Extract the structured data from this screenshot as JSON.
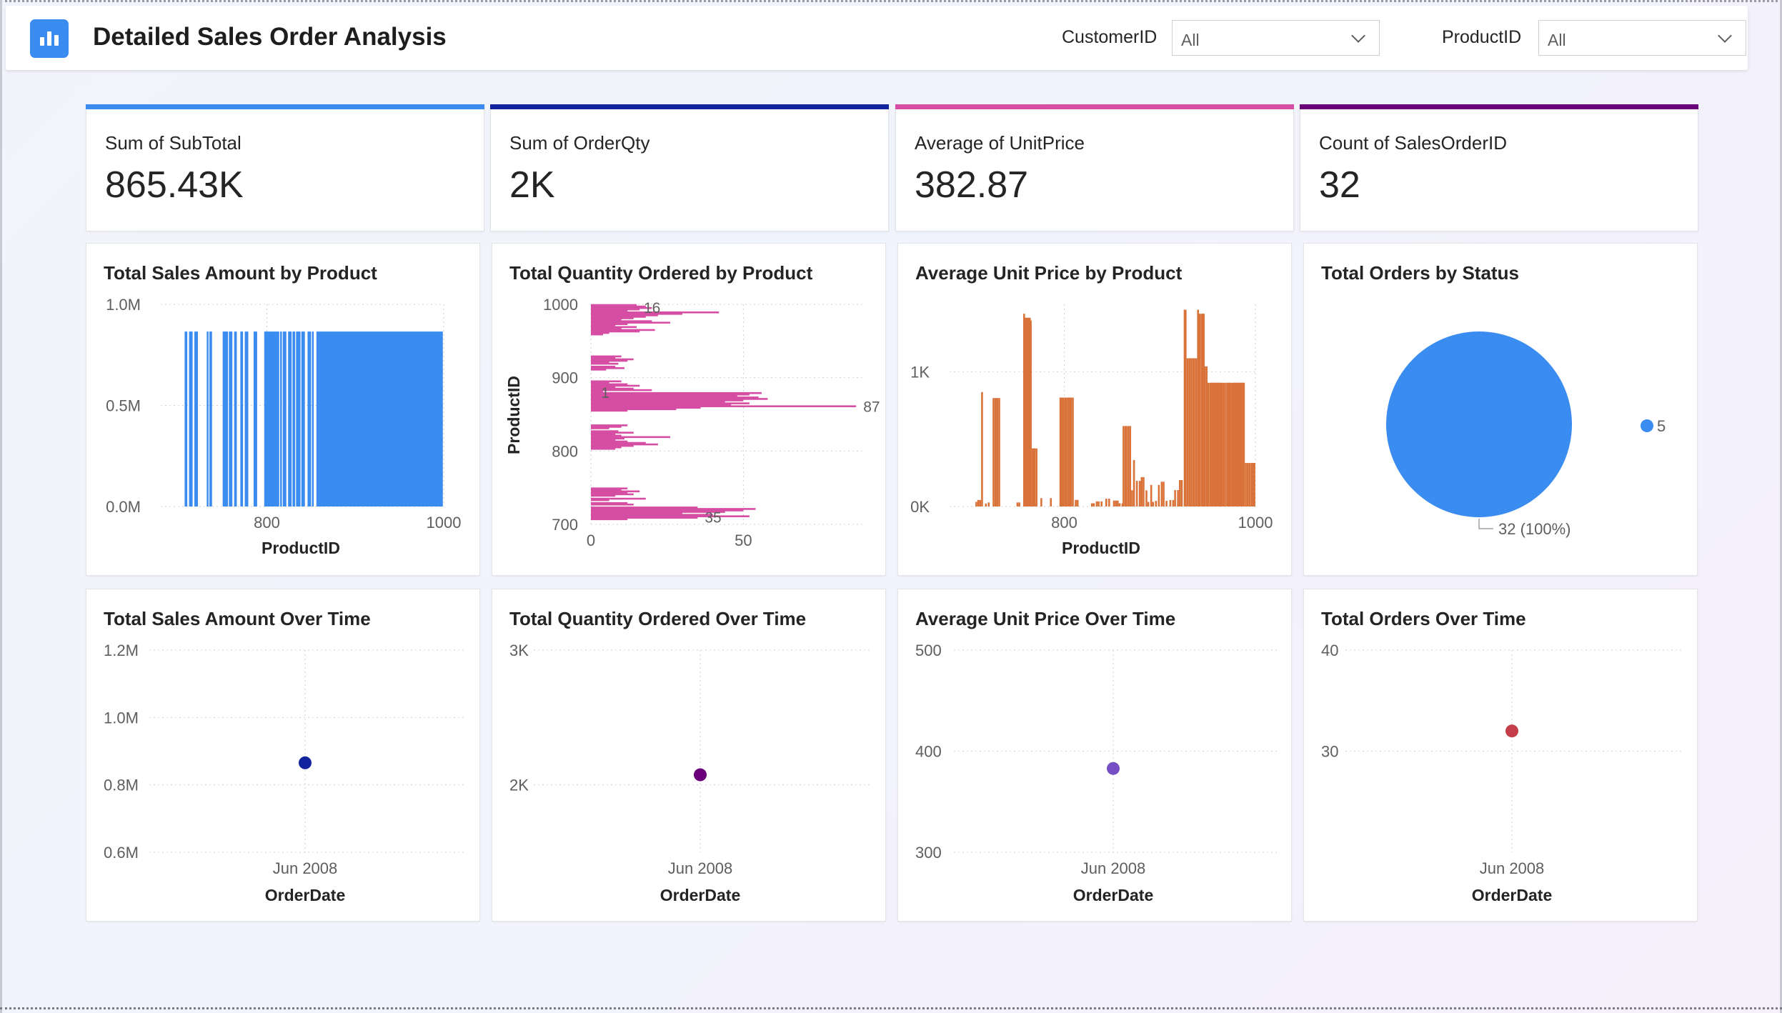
{
  "header": {
    "title": "Detailed Sales Order Analysis",
    "logo_icon": "bar-chart-icon",
    "slicers": [
      {
        "label": "CustomerID",
        "value": "All"
      },
      {
        "label": "ProductID",
        "value": "All"
      }
    ]
  },
  "kpis": [
    {
      "label": "Sum of SubTotal",
      "value": "865.43K",
      "color": "#3b8cf0"
    },
    {
      "label": "Sum of OrderQty",
      "value": "2K",
      "color": "#12239e"
    },
    {
      "label": "Average of UnitPrice",
      "value": "382.87",
      "color": "#d64ea3"
    },
    {
      "label": "Count of SalesOrderID",
      "value": "32",
      "color": "#6b007b"
    }
  ],
  "panels": {
    "sales_by_product": "Total Sales Amount by Product",
    "qty_by_product": "Total Quantity Ordered by Product",
    "price_by_product": "Average Unit Price by Product",
    "orders_by_status": "Total Orders by Status",
    "sales_over_time": "Total Sales Amount Over Time",
    "qty_over_time": "Total Quantity Ordered Over Time",
    "price_over_time": "Average Unit Price Over Time",
    "orders_over_time": "Total Orders Over Time"
  },
  "chart_data": [
    {
      "id": "sales_by_product",
      "type": "bar",
      "title": "Total Sales Amount by Product",
      "xlabel": "ProductID",
      "ylabel": "",
      "color": "#3b8cf0",
      "xlim": [
        680,
        1000
      ],
      "ylim": [
        0,
        1000000
      ],
      "x_ticks": [
        "800",
        "1000"
      ],
      "y_ticks": [
        "0.0M",
        "0.5M",
        "1.0M"
      ],
      "bar_value": 865430,
      "x_ranges": [
        [
          707,
          710
        ],
        [
          712,
          716
        ],
        [
          718,
          722
        ],
        [
          732,
          734
        ],
        [
          735,
          738
        ],
        [
          750,
          756
        ],
        [
          757,
          761
        ],
        [
          763,
          766
        ],
        [
          770,
          773
        ],
        [
          775,
          779
        ],
        [
          785,
          789
        ],
        [
          797,
          814
        ],
        [
          815,
          817
        ],
        [
          818,
          822
        ],
        [
          824,
          828
        ],
        [
          829,
          832
        ],
        [
          833,
          838
        ],
        [
          839,
          843
        ],
        [
          846,
          850
        ],
        [
          851,
          853
        ],
        [
          856,
          999
        ]
      ]
    },
    {
      "id": "qty_by_product",
      "type": "bar",
      "orientation": "horizontal",
      "title": "Total Quantity Ordered by Product",
      "xlabel": "",
      "ylabel": "ProductID",
      "color": "#d64ea3",
      "xlim": [
        0,
        90
      ],
      "ylim": [
        700,
        1000
      ],
      "x_ticks": [
        "0",
        "50"
      ],
      "y_ticks": [
        "700",
        "800",
        "900",
        "1000"
      ],
      "data_labels": [
        {
          "y": 996,
          "value": "16"
        },
        {
          "y": 880,
          "value": "1"
        },
        {
          "y": 861,
          "value": "87"
        },
        {
          "y": 710,
          "value": "35"
        }
      ],
      "bars": [
        [
          999,
          15
        ],
        [
          997,
          18
        ],
        [
          995,
          20
        ],
        [
          993,
          16
        ],
        [
          991,
          12
        ],
        [
          989,
          42
        ],
        [
          987,
          30
        ],
        [
          985,
          22
        ],
        [
          983,
          18
        ],
        [
          981,
          14
        ],
        [
          979,
          10
        ],
        [
          977,
          20
        ],
        [
          975,
          26
        ],
        [
          973,
          12
        ],
        [
          971,
          8
        ],
        [
          969,
          15
        ],
        [
          967,
          10
        ],
        [
          965,
          21
        ],
        [
          963,
          16
        ],
        [
          961,
          6
        ],
        [
          959,
          4
        ],
        [
          929,
          10
        ],
        [
          927,
          8
        ],
        [
          925,
          14
        ],
        [
          923,
          12
        ],
        [
          921,
          6
        ],
        [
          919,
          9
        ],
        [
          915,
          8
        ],
        [
          913,
          11
        ],
        [
          911,
          5
        ],
        [
          895,
          10
        ],
        [
          893,
          6
        ],
        [
          891,
          12
        ],
        [
          889,
          16
        ],
        [
          887,
          8
        ],
        [
          885,
          14
        ],
        [
          883,
          20
        ],
        [
          881,
          4
        ],
        [
          879,
          56
        ],
        [
          877,
          52
        ],
        [
          875,
          48
        ],
        [
          873,
          55
        ],
        [
          871,
          58
        ],
        [
          869,
          50
        ],
        [
          867,
          44
        ],
        [
          865,
          52
        ],
        [
          863,
          46
        ],
        [
          861,
          87
        ],
        [
          859,
          36
        ],
        [
          857,
          28
        ],
        [
          855,
          12
        ],
        [
          835,
          12
        ],
        [
          833,
          10
        ],
        [
          831,
          6
        ],
        [
          827,
          9
        ],
        [
          825,
          14
        ],
        [
          823,
          8
        ],
        [
          821,
          10
        ],
        [
          819,
          26
        ],
        [
          817,
          11
        ],
        [
          815,
          8
        ],
        [
          813,
          12
        ],
        [
          811,
          18
        ],
        [
          809,
          22
        ],
        [
          807,
          14
        ],
        [
          805,
          10
        ],
        [
          803,
          8
        ],
        [
          749,
          12
        ],
        [
          747,
          10
        ],
        [
          745,
          16
        ],
        [
          743,
          12
        ],
        [
          741,
          14
        ],
        [
          739,
          8
        ],
        [
          735,
          18
        ],
        [
          733,
          6
        ],
        [
          729,
          12
        ],
        [
          727,
          14
        ],
        [
          723,
          35
        ],
        [
          721,
          54
        ],
        [
          719,
          50
        ],
        [
          717,
          44
        ],
        [
          715,
          30
        ],
        [
          713,
          40
        ],
        [
          711,
          52
        ],
        [
          709,
          35
        ],
        [
          707,
          12
        ]
      ]
    },
    {
      "id": "price_by_product",
      "type": "bar",
      "title": "Average Unit Price by Product",
      "xlabel": "ProductID",
      "ylabel": "",
      "color": "#d9733a",
      "xlim": [
        680,
        1000
      ],
      "ylim": [
        0,
        1500
      ],
      "x_ticks": [
        "800",
        "1000"
      ],
      "y_ticks": [
        "0K",
        "1K"
      ],
      "bars": [
        [
          707,
          34
        ],
        [
          709,
          49
        ],
        [
          711,
          48
        ],
        [
          713,
          849
        ],
        [
          717,
          22
        ],
        [
          720,
          30
        ],
        [
          725,
          805
        ],
        [
          727,
          805
        ],
        [
          729,
          805
        ],
        [
          731,
          805
        ],
        [
          750,
          30
        ],
        [
          752,
          30
        ],
        [
          757,
          1430
        ],
        [
          758,
          1400
        ],
        [
          759,
          1400
        ],
        [
          760,
          1400
        ],
        [
          761,
          1400
        ],
        [
          762,
          1400
        ],
        [
          763,
          1400
        ],
        [
          764,
          1380
        ],
        [
          766,
          431
        ],
        [
          767,
          431
        ],
        [
          768,
          431
        ],
        [
          770,
          431
        ],
        [
          775,
          62
        ],
        [
          785,
          62
        ],
        [
          795,
          808
        ],
        [
          796,
          808
        ],
        [
          797,
          808
        ],
        [
          798,
          808
        ],
        [
          800,
          808
        ],
        [
          801,
          808
        ],
        [
          803,
          808
        ],
        [
          804,
          808
        ],
        [
          805,
          808
        ],
        [
          806,
          808
        ],
        [
          808,
          808
        ],
        [
          811,
          49
        ],
        [
          813,
          49
        ],
        [
          828,
          24
        ],
        [
          830,
          24
        ],
        [
          833,
          38
        ],
        [
          835,
          38
        ],
        [
          838,
          38
        ],
        [
          843,
          58
        ],
        [
          846,
          58
        ],
        [
          851,
          44
        ],
        [
          853,
          44
        ],
        [
          855,
          44
        ],
        [
          857,
          24
        ],
        [
          860,
          24
        ],
        [
          861,
          597
        ],
        [
          863,
          597
        ],
        [
          864,
          597
        ],
        [
          866,
          597
        ],
        [
          868,
          597
        ],
        [
          870,
          120
        ],
        [
          872,
          345
        ],
        [
          875,
          190
        ],
        [
          878,
          190
        ],
        [
          880,
          218
        ],
        [
          882,
          218
        ],
        [
          885,
          120
        ],
        [
          887,
          34
        ],
        [
          890,
          160
        ],
        [
          892,
          34
        ],
        [
          895,
          42
        ],
        [
          898,
          160
        ],
        [
          901,
          184
        ],
        [
          903,
          184
        ],
        [
          906,
          42
        ],
        [
          910,
          48
        ],
        [
          913,
          48
        ],
        [
          915,
          122
        ],
        [
          918,
          122
        ],
        [
          920,
          196
        ],
        [
          922,
          196
        ],
        [
          925,
          1460
        ],
        [
          926,
          1460
        ],
        [
          928,
          1100
        ],
        [
          930,
          1100
        ],
        [
          932,
          1100
        ],
        [
          934,
          1100
        ],
        [
          935,
          1100
        ],
        [
          937,
          1100
        ],
        [
          939,
          1460
        ],
        [
          940,
          1430
        ],
        [
          941,
          1430
        ],
        [
          943,
          1430
        ],
        [
          944,
          1430
        ],
        [
          945,
          1430
        ],
        [
          946,
          1040
        ],
        [
          948,
          1040
        ],
        [
          949,
          918
        ],
        [
          950,
          918
        ],
        [
          952,
          918
        ],
        [
          953,
          918
        ],
        [
          954,
          918
        ],
        [
          955,
          918
        ],
        [
          956,
          918
        ],
        [
          957,
          918
        ],
        [
          958,
          918
        ],
        [
          959,
          918
        ],
        [
          960,
          918
        ],
        [
          961,
          918
        ],
        [
          962,
          918
        ],
        [
          963,
          918
        ],
        [
          964,
          918
        ],
        [
          966,
          918
        ],
        [
          968,
          918
        ],
        [
          970,
          918
        ],
        [
          971,
          918
        ],
        [
          972,
          918
        ],
        [
          973,
          918
        ],
        [
          975,
          918
        ],
        [
          976,
          918
        ],
        [
          977,
          918
        ],
        [
          978,
          918
        ],
        [
          979,
          918
        ],
        [
          980,
          918
        ],
        [
          981,
          918
        ],
        [
          982,
          918
        ],
        [
          983,
          918
        ],
        [
          984,
          918
        ],
        [
          985,
          918
        ],
        [
          986,
          918
        ],
        [
          987,
          918
        ],
        [
          989,
          323
        ],
        [
          991,
          323
        ],
        [
          993,
          323
        ],
        [
          995,
          323
        ],
        [
          996,
          323
        ],
        [
          997,
          323
        ],
        [
          998,
          323
        ]
      ]
    },
    {
      "id": "orders_by_status",
      "type": "pie",
      "title": "Total Orders by Status",
      "slices": [
        {
          "name": "5",
          "value": 32
        }
      ],
      "data_label": "32 (100%)",
      "legend": "right",
      "color": "#3b8cf0"
    },
    {
      "id": "sales_over_time",
      "type": "scatter",
      "title": "Total Sales Amount Over Time",
      "xlabel": "OrderDate",
      "x_ticks": [
        "Jun 2008"
      ],
      "y_ticks": [
        "0.6M",
        "0.8M",
        "1.0M",
        "1.2M"
      ],
      "ylim": [
        600000,
        1200000
      ],
      "points": [
        {
          "x": "Jun 2008",
          "y": 865430
        }
      ],
      "color": "#12239e"
    },
    {
      "id": "qty_over_time",
      "type": "scatter",
      "title": "Total Quantity Ordered Over Time",
      "xlabel": "OrderDate",
      "x_ticks": [
        "Jun 2008"
      ],
      "y_ticks": [
        "2K",
        "3K"
      ],
      "ylim": [
        1500,
        3000
      ],
      "points": [
        {
          "x": "Jun 2008",
          "y": 2075
        }
      ],
      "color": "#6b007b"
    },
    {
      "id": "price_over_time",
      "type": "scatter",
      "title": "Average Unit Price Over Time",
      "xlabel": "OrderDate",
      "x_ticks": [
        "Jun 2008"
      ],
      "y_ticks": [
        "300",
        "400",
        "500"
      ],
      "ylim": [
        300,
        500
      ],
      "points": [
        {
          "x": "Jun 2008",
          "y": 382.87
        }
      ],
      "color": "#744ec2"
    },
    {
      "id": "orders_over_time",
      "type": "scatter",
      "title": "Total Orders Over Time",
      "xlabel": "OrderDate",
      "x_ticks": [
        "Jun 2008"
      ],
      "y_ticks": [
        "30",
        "40"
      ],
      "ylim": [
        20,
        40
      ],
      "points": [
        {
          "x": "Jun 2008",
          "y": 32
        }
      ],
      "color": "#c43d4b"
    }
  ]
}
